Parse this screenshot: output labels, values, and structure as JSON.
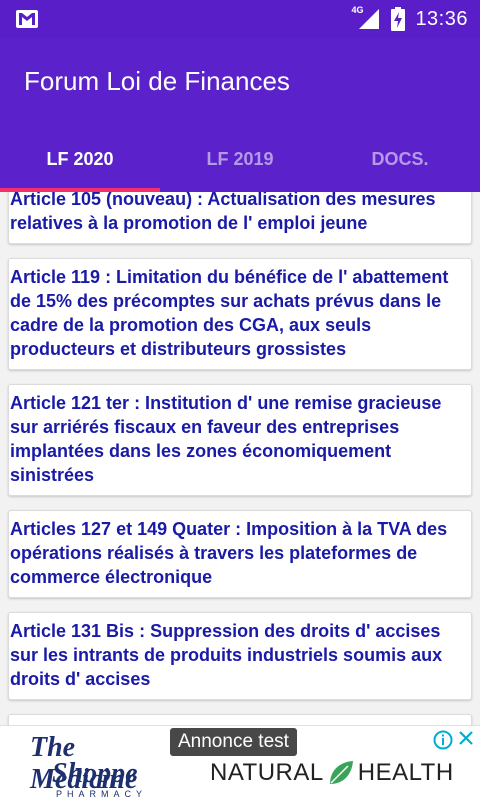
{
  "status_bar": {
    "network_label": "4G",
    "time": "13:36"
  },
  "app_bar": {
    "title": "Forum Loi de Finances"
  },
  "tabs": [
    {
      "label": "LF 2020",
      "active": true
    },
    {
      "label": "LF 2019",
      "active": false
    },
    {
      "label": "DOCS.",
      "active": false
    }
  ],
  "articles": [
    {
      "text": "Article 105 (nouveau) : Actualisation des mesures relatives à la promotion de l' emploi jeune"
    },
    {
      "text": "Article 119 : Limitation du bénéfice de l' abattement de 15% des précomptes sur achats prévus dans le cadre de la promotion des CGA, aux seuls producteurs et distributeurs grossistes"
    },
    {
      "text": "Article 121 ter : Institution d' une remise gracieuse sur arriérés fiscaux en faveur des entreprises implantées dans les zones économiquement sinistrées"
    },
    {
      "text": "Articles 127 et 149 Quater : Imposition à la TVA des opérations réalisés à travers les plateformes de commerce électronique"
    },
    {
      "text": "Article 131 Bis : Suppression des droits d' accises sur les intrants de produits industriels soumis aux droits d' accises"
    },
    {
      "text": ""
    }
  ],
  "ad": {
    "badge": "Annonce test",
    "brand_line1": "The Medicine",
    "brand_line2": "Shoppe",
    "brand_line3": "PHARMACY",
    "natural_left": "NATURAL",
    "natural_right": "HEALTH"
  },
  "colors": {
    "app_bar": "#5b22cb",
    "tab_indicator": "#f4306c",
    "article_text": "#1a1aa8"
  }
}
